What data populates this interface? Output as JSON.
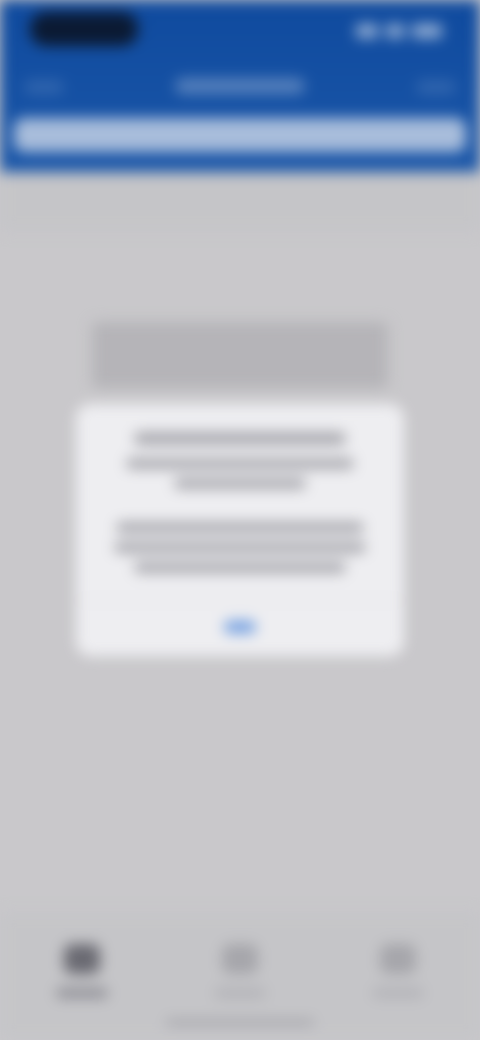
{
  "colors": {
    "header": "#1a56a8",
    "background": "#c9c8cb",
    "dialog": "#eeeef1",
    "accent": "#6c9be0"
  },
  "icons": {
    "tab1": "tab-icon",
    "tab2": "tab-icon",
    "tab3": "tab-icon"
  },
  "note_blurred": true
}
